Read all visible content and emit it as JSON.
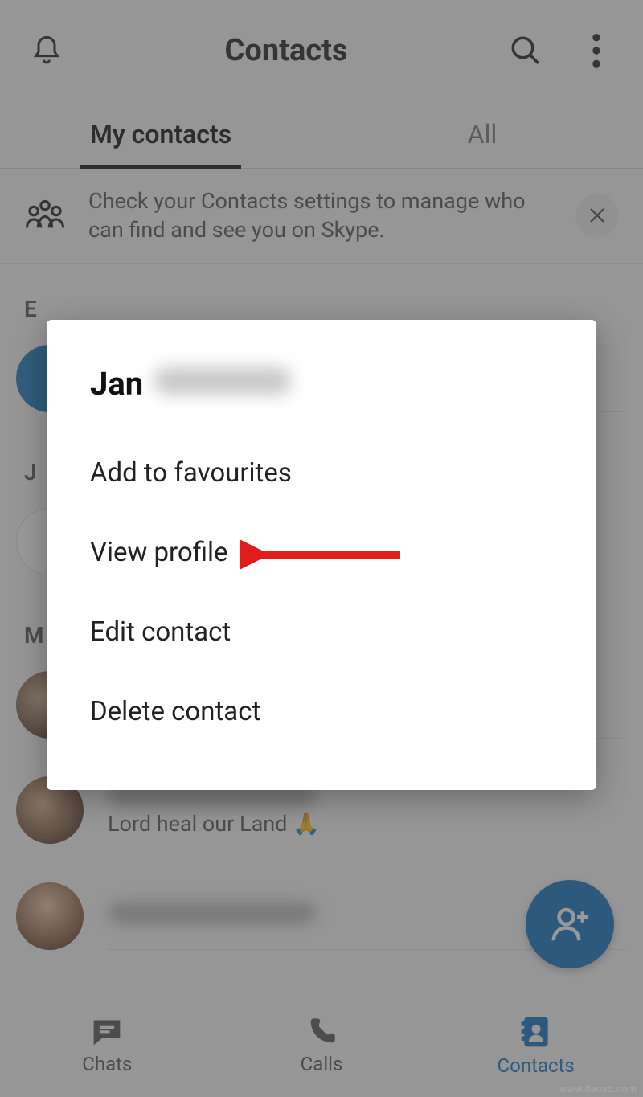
{
  "header": {
    "title": "Contacts"
  },
  "tabs": {
    "my_contacts": "My contacts",
    "all": "All"
  },
  "banner": {
    "text": "Check your Contacts settings to manage who can find and see you on Skype."
  },
  "sections": {
    "e": "E",
    "j": "J",
    "m": "M"
  },
  "contact_status": {
    "lord_heal": "Lord heal our Land 🙏"
  },
  "dialog": {
    "name_first": "Jan",
    "add_favourites": "Add to favourites",
    "view_profile": "View profile",
    "edit_contact": "Edit contact",
    "delete_contact": "Delete contact"
  },
  "bottom_nav": {
    "chats": "Chats",
    "calls": "Calls",
    "contacts": "Contacts"
  },
  "watermark": "www.deuaq.com"
}
